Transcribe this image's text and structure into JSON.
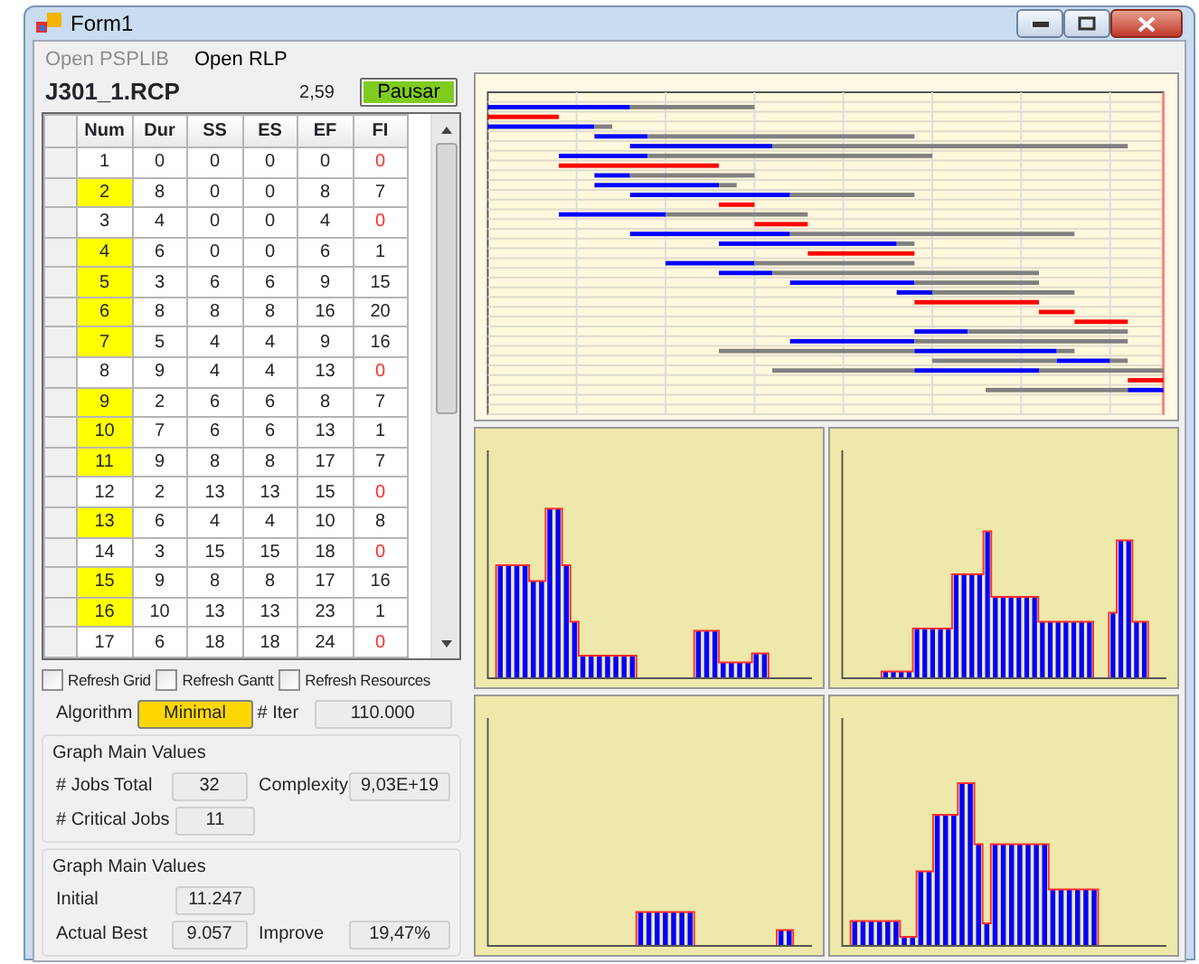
{
  "window": {
    "title": "Form1"
  },
  "menu": [
    {
      "label": "Open PSPLIB",
      "disabled": true
    },
    {
      "label": "Open RLP",
      "disabled": false
    }
  ],
  "file_name": "J301_1.RCP",
  "timer": "2,59",
  "pause_button": "Pausar",
  "grid": {
    "columns": [
      "Num",
      "Dur",
      "SS",
      "ES",
      "EF",
      "FI"
    ],
    "rows": [
      {
        "cells": [
          "1",
          "0",
          "0",
          "0",
          "0",
          "0"
        ],
        "highlighted": false,
        "fi_alert": true
      },
      {
        "cells": [
          "2",
          "8",
          "0",
          "0",
          "8",
          "7"
        ],
        "highlighted": true,
        "fi_alert": false
      },
      {
        "cells": [
          "3",
          "4",
          "0",
          "0",
          "4",
          "0"
        ],
        "highlighted": false,
        "fi_alert": true
      },
      {
        "cells": [
          "4",
          "6",
          "0",
          "0",
          "6",
          "1"
        ],
        "highlighted": true,
        "fi_alert": false
      },
      {
        "cells": [
          "5",
          "3",
          "6",
          "6",
          "9",
          "15"
        ],
        "highlighted": true,
        "fi_alert": false
      },
      {
        "cells": [
          "6",
          "8",
          "8",
          "8",
          "16",
          "20"
        ],
        "highlighted": true,
        "fi_alert": false
      },
      {
        "cells": [
          "7",
          "5",
          "4",
          "4",
          "9",
          "16"
        ],
        "highlighted": true,
        "fi_alert": false
      },
      {
        "cells": [
          "8",
          "9",
          "4",
          "4",
          "13",
          "0"
        ],
        "highlighted": false,
        "fi_alert": true
      },
      {
        "cells": [
          "9",
          "2",
          "6",
          "6",
          "8",
          "7"
        ],
        "highlighted": true,
        "fi_alert": false
      },
      {
        "cells": [
          "10",
          "7",
          "6",
          "6",
          "13",
          "1"
        ],
        "highlighted": true,
        "fi_alert": false
      },
      {
        "cells": [
          "11",
          "9",
          "8",
          "8",
          "17",
          "7"
        ],
        "highlighted": true,
        "fi_alert": false
      },
      {
        "cells": [
          "12",
          "2",
          "13",
          "13",
          "15",
          "0"
        ],
        "highlighted": false,
        "fi_alert": true
      },
      {
        "cells": [
          "13",
          "6",
          "4",
          "4",
          "10",
          "8"
        ],
        "highlighted": true,
        "fi_alert": false
      },
      {
        "cells": [
          "14",
          "3",
          "15",
          "15",
          "18",
          "0"
        ],
        "highlighted": false,
        "fi_alert": true
      },
      {
        "cells": [
          "15",
          "9",
          "8",
          "8",
          "17",
          "16"
        ],
        "highlighted": true,
        "fi_alert": false
      },
      {
        "cells": [
          "16",
          "10",
          "13",
          "13",
          "23",
          "1"
        ],
        "highlighted": true,
        "fi_alert": false
      },
      {
        "cells": [
          "17",
          "6",
          "18",
          "18",
          "24",
          "0"
        ],
        "highlighted": false,
        "fi_alert": true
      }
    ]
  },
  "options": [
    {
      "label": "Refresh Grid",
      "checked": false
    },
    {
      "label": "Refresh Gantt",
      "checked": false
    },
    {
      "label": "Refresh Resources",
      "checked": false
    }
  ],
  "algorithm": {
    "label": "Algorithm",
    "value": "Minimal"
  },
  "iterations": {
    "label": "# Iter",
    "value": "110.000"
  },
  "groups": [
    {
      "title": "Graph Main Values",
      "rows": [
        [
          {
            "label": "# Jobs Total",
            "value": "32"
          },
          {
            "label": "Complexity",
            "value": "9,03E+19"
          }
        ],
        [
          {
            "label": "# Critical Jobs",
            "value": "11"
          }
        ]
      ]
    },
    {
      "title": "Graph Main Values",
      "rows": [
        [
          {
            "label": "Initial",
            "value": "11.247"
          }
        ],
        [
          {
            "label": "Actual Best",
            "value": "9.057"
          },
          {
            "label": "Improve",
            "value": "19,47%"
          }
        ]
      ]
    }
  ]
}
